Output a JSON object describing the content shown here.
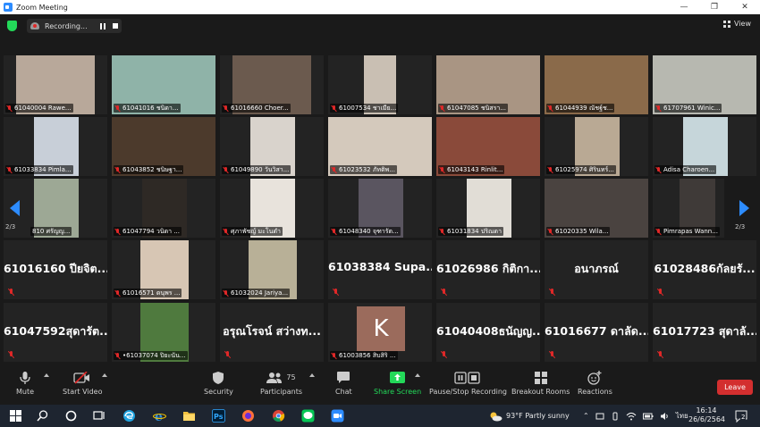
{
  "window": {
    "title": "Zoom Meeting",
    "minimize": "—",
    "maximize": "❐",
    "close": "✕"
  },
  "topbar": {
    "recording_label": "Recording...",
    "view_label": "View"
  },
  "gallery": {
    "page_indicator_left": "2/3",
    "page_indicator_right": "2/3",
    "video_tiles": [
      {
        "name": "61040004 Rawe...",
        "color": "#b8a89a"
      },
      {
        "name": "61041016 ชนิดา...",
        "color": "#8fb3a8"
      },
      {
        "name": "61016660 Choer...",
        "color": "#6b5a4e"
      },
      {
        "name": "61007534 ชาเมีย...",
        "color": "#c9bfb3"
      },
      {
        "name": "61047085 ชนิสรา...",
        "color": "#a99583"
      },
      {
        "name": "61044939 ณัชฐ์ช...",
        "color": "#8a6a4a"
      },
      {
        "name": "61707961 Winic...",
        "color": "#b7b8b0"
      },
      {
        "name": "61033834 Pimla...",
        "color": "#c8cfd8"
      },
      {
        "name": "61043852 ชนิษฐา...",
        "color": "#4c3a2c"
      },
      {
        "name": "61049890 วันวิสา...",
        "color": "#d9d3cc"
      },
      {
        "name": "61023532 ภัทติพ...",
        "color": "#d4c9bc"
      },
      {
        "name": "61043143 Rinlit...",
        "color": "#8a4a3a"
      },
      {
        "name": "61025974 ศิรินทร์...",
        "color": "#b9a994"
      },
      {
        "name": "Adisa Charoen...",
        "color": "#c6d6da"
      },
      {
        "name": "810 ศรัญญ...",
        "color": "#9da895"
      },
      {
        "name": "61047794 วนิดา ...",
        "color": "#2e2925"
      },
      {
        "name": "ศุภาพัชญ์ มะโนดำ",
        "color": "#e8e3dc"
      },
      {
        "name": "61048340 จุฑารัต...",
        "color": "#5a5560"
      },
      {
        "name": "61031834 ปริณดา",
        "color": "#e1ddd6"
      },
      {
        "name": "61020335 Wila...",
        "color": "#4a4340"
      },
      {
        "name": "Pimrapas Wann...",
        "color": "#3f3a38"
      },
      {
        "name": "61016571 ดนุพร ...",
        "color": "#d7c6b4"
      },
      {
        "name": "61032024 Jariya...",
        "color": "#b8b097"
      },
      {
        "name": "•61037074 ปิยะนัน...",
        "color": "#4f7a3e"
      },
      {
        "name": "61003856 สิบสิริ ...",
        "color": "#9b6b5c"
      }
    ],
    "name_tiles": [
      "61016160 ปียจิต...",
      "61038384 Supa...",
      "61026986 กิติกา...",
      "อนาภรณ์",
      "61028486กัลยรั...",
      "61047592สุดารัต...",
      "อรุณโรจน์ สว่างท...",
      "61040408ธนัญญ...",
      "61016677 ดาลัด...",
      "61017723 สุดาลั..."
    ],
    "avatar_letter": "K"
  },
  "toolbar": {
    "mute": "Mute",
    "start_video": "Start Video",
    "security": "Security",
    "participants": "Participants",
    "participants_count": "75",
    "chat": "Chat",
    "share_screen": "Share Screen",
    "record": "Pause/Stop Recording",
    "breakout": "Breakout Rooms",
    "reactions": "Reactions",
    "leave": "Leave"
  },
  "taskbar": {
    "weather": "93°F  Partly sunny",
    "language": "ไทย",
    "time": "16:14",
    "date": "26/6/2564",
    "notifications": "2"
  },
  "colors": {
    "accent": "#2d8cff",
    "leave": "#d32f2f",
    "share": "#23d959",
    "muted": "#e02828"
  }
}
